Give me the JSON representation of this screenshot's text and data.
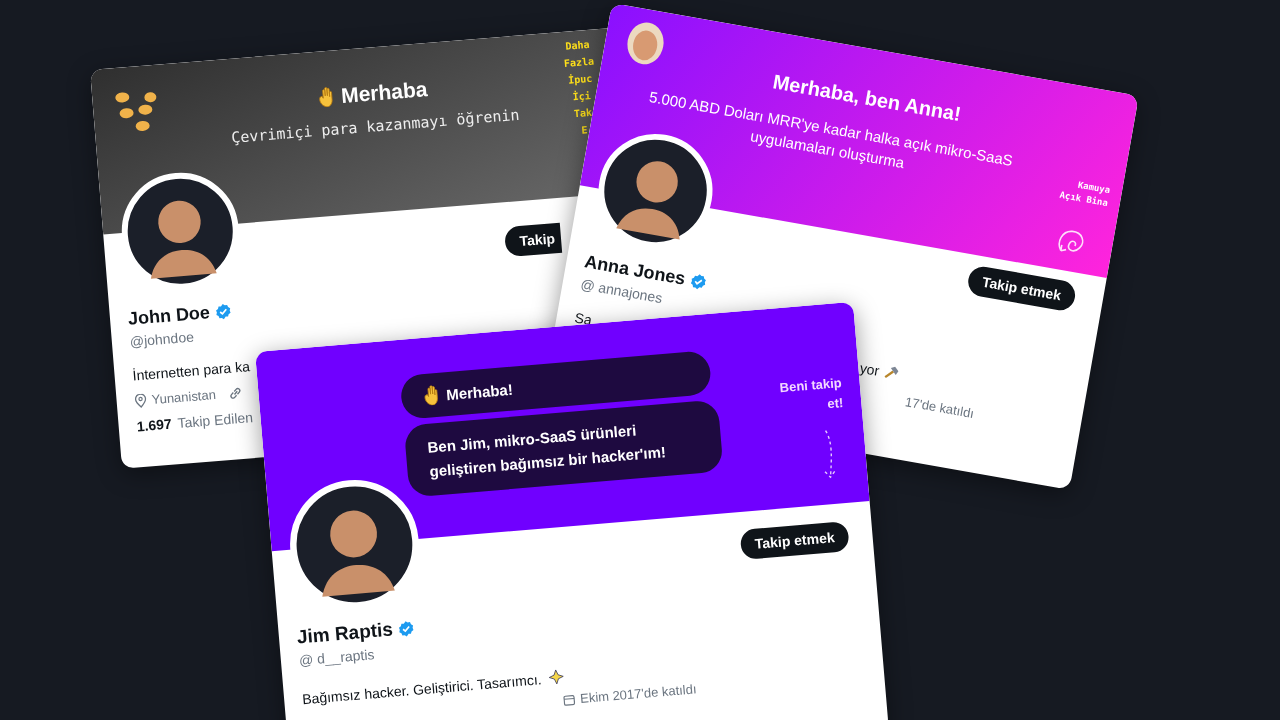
{
  "cards": [
    {
      "kind": "banner-text",
      "banner": {
        "title": "Merhaba",
        "subtitle": "Çevrimiçi para kazanmayı öğrenin",
        "side_lines": [
          "Daha",
          "Fazla",
          "İpuc",
          "İçi",
          "Tak",
          "E"
        ]
      },
      "follow_button": "Takip",
      "name": "John Doe",
      "verified": true,
      "handle": "@johndoe",
      "bio": "İnternetten para ka",
      "location": "Yunanistan",
      "following_count": "1.697",
      "following_label": "Takip Edilen"
    },
    {
      "kind": "gradient",
      "banner": {
        "title": "Merhaba, ben Anna!",
        "description": "5.000 ABD Doları MRR'ye kadar halka açık mikro-SaaS uygulamaları oluşturma",
        "side_lines": [
          "Kamuya",
          "Açık Bina"
        ]
      },
      "follow_button": "Takip etmek",
      "name": "Anna Jones",
      "verified": true,
      "handle": "@ annajones",
      "bio_start": "Sa",
      "bio_end": "yor",
      "joined": "17'de katıldı"
    },
    {
      "kind": "chat",
      "banner": {
        "bubbles": [
          "Merhaba!",
          "Ben Jim, mikro-SaaS ürünleri geliştiren bağımsız bir hacker'ım!"
        ],
        "callout": "Beni takip et!"
      },
      "follow_button": "Takip etmek",
      "name": "Jim Raptis",
      "verified": true,
      "handle": "@ d__raptis",
      "bio": "Bağımsız hacker. Geliştirici. Tasarımcı.",
      "joined": "Ekim 2017'de katıldı"
    }
  ]
}
